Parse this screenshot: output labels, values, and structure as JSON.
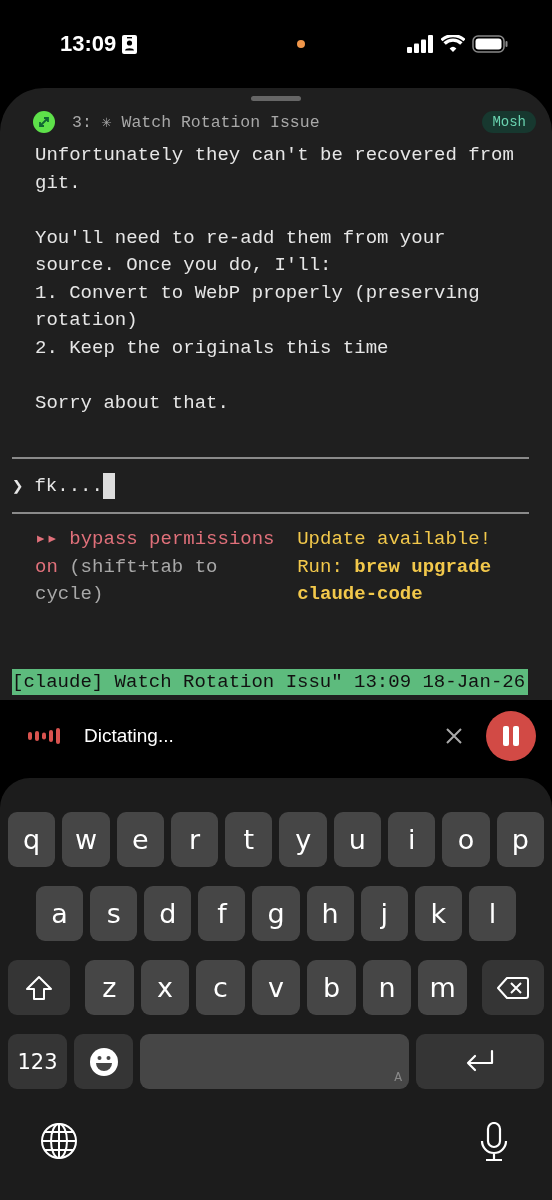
{
  "status_bar": {
    "time": "13:09"
  },
  "session": {
    "title": "3: ✳ Watch Rotation Issue",
    "badge": "Mosh"
  },
  "terminal": {
    "paragraphs": [
      {
        "lines": [
          "Unfortunately they can't be recovered from",
          "git."
        ]
      },
      {
        "lines": [
          "You'll need to re-add them from your",
          "source. Once you do, I'll:",
          "1. Convert to WebP properly (preserving",
          "rotation)",
          "2. Keep the originals this time"
        ]
      },
      {
        "lines": [
          "Sorry about that."
        ]
      }
    ],
    "prompt": {
      "symbol": "❯",
      "value": "fk...."
    },
    "mode": {
      "label": "▸▸ bypass permissions on",
      "hint": "(shift+tab to cycle)"
    },
    "update": {
      "title": "Update available!",
      "command": "Run: **brew upgrade claude-code**"
    },
    "tmux_status": "[claude] Watch Rotation Issu\" 13:09 18-Jan-26"
  },
  "dictation": {
    "label": "Dictating..."
  },
  "keyboard": {
    "rows": [
      {
        "keys": [
          {
            "kind": "letter",
            "label": "q"
          },
          {
            "kind": "letter",
            "label": "w"
          },
          {
            "kind": "letter",
            "label": "e"
          },
          {
            "kind": "letter",
            "label": "r"
          },
          {
            "kind": "letter",
            "label": "t"
          },
          {
            "kind": "letter",
            "label": "y"
          },
          {
            "kind": "letter",
            "label": "u"
          },
          {
            "kind": "letter",
            "label": "i"
          },
          {
            "kind": "letter",
            "label": "o"
          },
          {
            "kind": "letter",
            "label": "p"
          }
        ]
      },
      {
        "keys": [
          {
            "kind": "letter",
            "label": "a"
          },
          {
            "kind": "letter",
            "label": "s"
          },
          {
            "kind": "letter",
            "label": "d"
          },
          {
            "kind": "letter",
            "label": "f"
          },
          {
            "kind": "letter",
            "label": "g"
          },
          {
            "kind": "letter",
            "label": "h"
          },
          {
            "kind": "letter",
            "label": "j"
          },
          {
            "kind": "letter",
            "label": "k"
          },
          {
            "kind": "letter",
            "label": "l"
          }
        ]
      },
      {
        "keys": [
          {
            "kind": "shift"
          },
          {
            "kind": "letter",
            "label": "z"
          },
          {
            "kind": "letter",
            "label": "x"
          },
          {
            "kind": "letter",
            "label": "c"
          },
          {
            "kind": "letter",
            "label": "v"
          },
          {
            "kind": "letter",
            "label": "b"
          },
          {
            "kind": "letter",
            "label": "n"
          },
          {
            "kind": "letter",
            "label": "m"
          },
          {
            "kind": "delete"
          }
        ]
      },
      {
        "keys": [
          {
            "kind": "numbers",
            "label": "123"
          },
          {
            "kind": "emoji"
          },
          {
            "kind": "space",
            "label": "A"
          },
          {
            "kind": "return"
          }
        ]
      }
    ]
  }
}
